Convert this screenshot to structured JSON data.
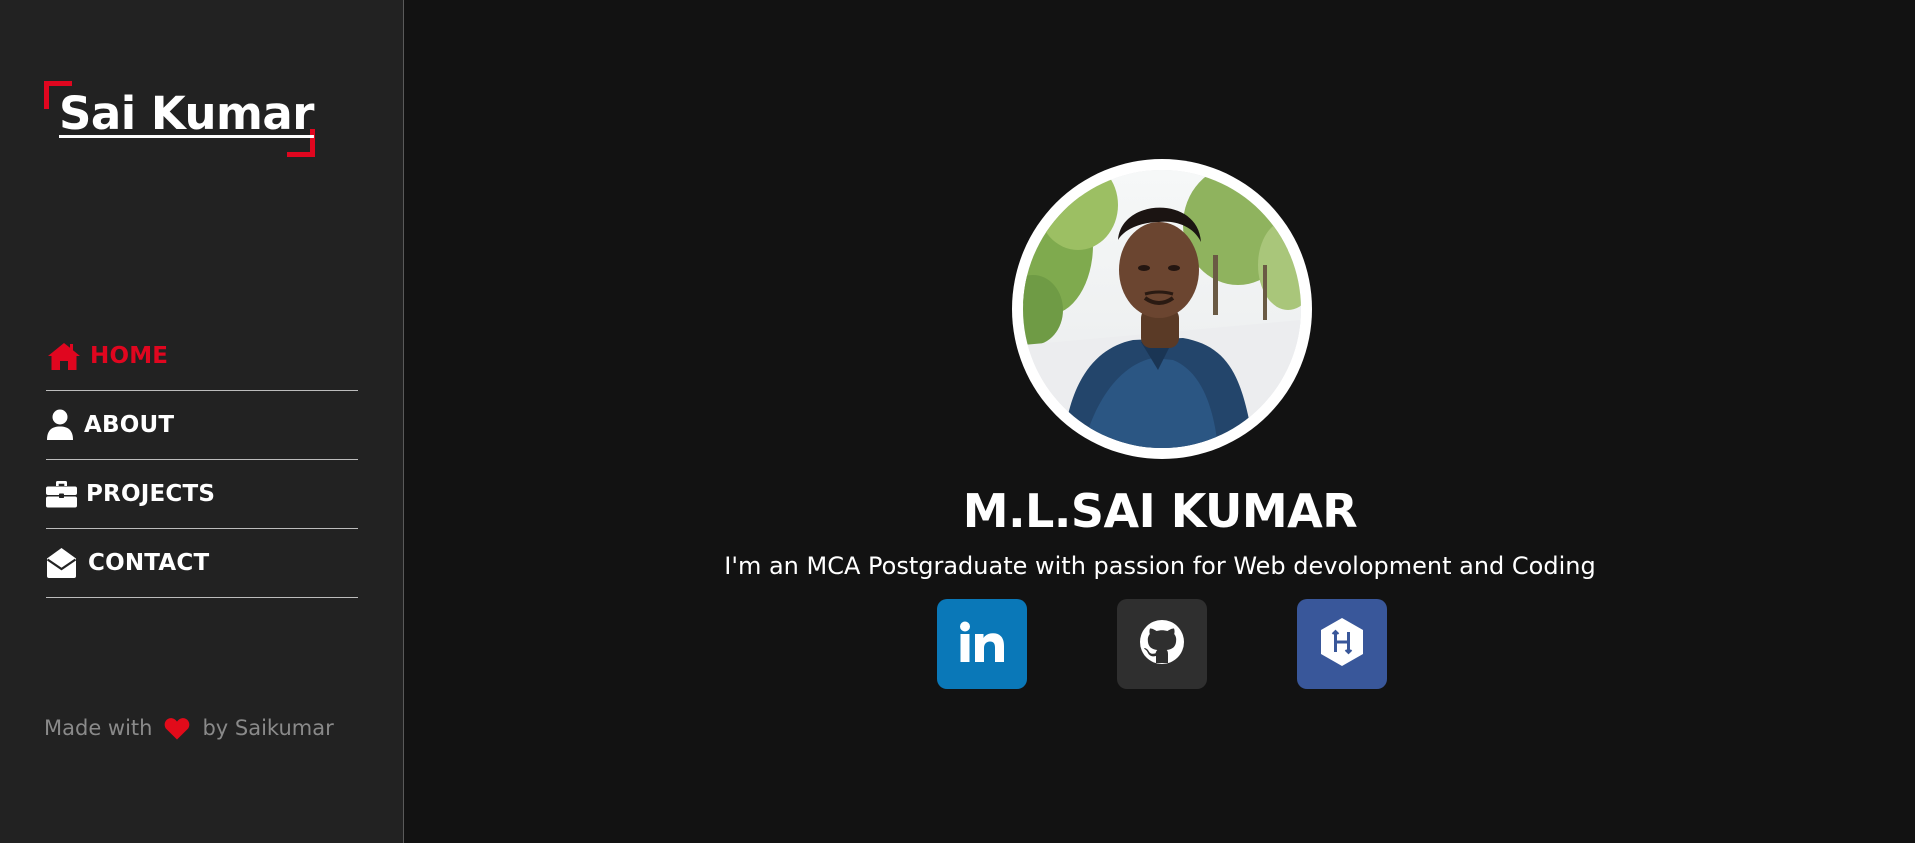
{
  "logo": {
    "text": "Sai Kumar",
    "accent_color": "#e0061f"
  },
  "nav": {
    "items": [
      {
        "label": "HOME",
        "icon": "home-icon",
        "active": true
      },
      {
        "label": "ABOUT",
        "icon": "user-icon",
        "active": false
      },
      {
        "label": "PROJECTS",
        "icon": "briefcase-icon",
        "active": false
      },
      {
        "label": "CONTACT",
        "icon": "envelope-open-icon",
        "active": false
      }
    ]
  },
  "footer": {
    "prefix": "Made with",
    "icon": "heart-icon",
    "suffix": "by Saikumar"
  },
  "hero": {
    "avatar": "profile-photo",
    "name": "M.L.SAI KUMAR",
    "tagline": "I'm an MCA Postgraduate with passion for Web devolopment and Coding"
  },
  "socials": [
    {
      "icon": "linkedin-icon",
      "color": "#0a78b8"
    },
    {
      "icon": "github-icon",
      "color": "#2f2f2f"
    },
    {
      "icon": "hackerrank-icon",
      "color": "#39579a"
    }
  ],
  "colors": {
    "sidebar_bg": "#222222",
    "main_bg": "#121212",
    "accent": "#e0061f",
    "text": "#ffffff",
    "muted": "#8a8a8a"
  }
}
